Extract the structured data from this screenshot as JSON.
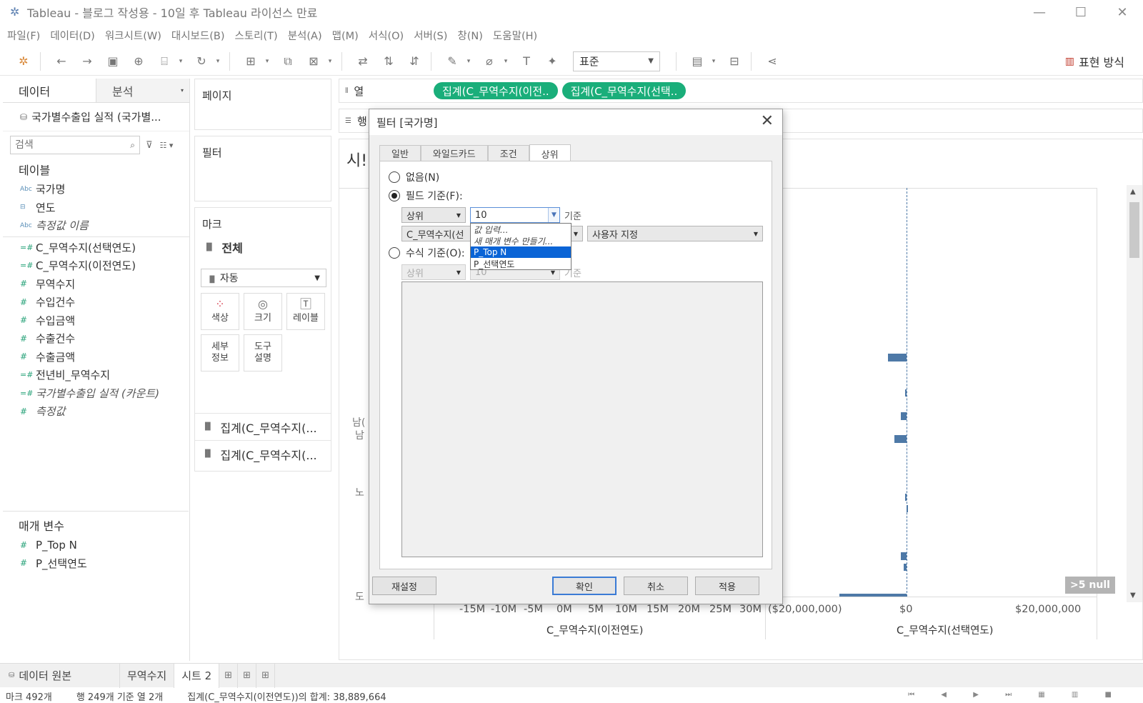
{
  "window": {
    "title": "Tableau - 블로그 작성용 - 10일 후 Tableau 라이선스 만료"
  },
  "menu": [
    "파일(F)",
    "데이터(D)",
    "워크시트(W)",
    "대시보드(B)",
    "스토리(T)",
    "분석(A)",
    "맵(M)",
    "서식(O)",
    "서버(S)",
    "창(N)",
    "도움말(H)"
  ],
  "toolbar": {
    "fit_value": "표준",
    "show_me_label": "표현 방식"
  },
  "data_pane": {
    "tab_data": "데이터",
    "tab_analytics": "분석",
    "datasource": "국가별수출입 실적 (국가별...",
    "search_placeholder": "검색",
    "tables_header": "테이블",
    "fields": [
      {
        "type": "Abc",
        "name": "국가명"
      },
      {
        "type": "date",
        "name": "연도"
      },
      {
        "type": "Abc",
        "name": "측정값 이름"
      },
      {
        "type": "=#",
        "name": "C_무역수지(선택연도)"
      },
      {
        "type": "=#",
        "name": "C_무역수지(이전연도)"
      },
      {
        "type": "#",
        "name": "무역수지"
      },
      {
        "type": "#",
        "name": "수입건수"
      },
      {
        "type": "#",
        "name": "수입금액"
      },
      {
        "type": "#",
        "name": "수출건수"
      },
      {
        "type": "#",
        "name": "수출금액"
      },
      {
        "type": "=#",
        "name": "전년비_무역수지"
      },
      {
        "type": "=#",
        "name": "국가별수출입 실적 (카운트)"
      },
      {
        "type": "#",
        "name": "측정값"
      }
    ],
    "params_header": "매개 변수",
    "params": [
      "P_Top N",
      "P_선택연도"
    ]
  },
  "shelves": {
    "pages": "페이지",
    "filters": "필터",
    "marks": "마크",
    "marks_all": "전체",
    "mark_type": "자동",
    "mark_buttons": [
      "색상",
      "크기",
      "레이블",
      "세부\n정보",
      "도구\n설명"
    ],
    "mark_pills": [
      "집계(C_무역수지(...",
      "집계(C_무역수지(..."
    ],
    "columns_label": "열",
    "rows_label": "행",
    "column_pills": [
      "집계(C_무역수지(이전..",
      "집계(C_무역수지(선택.."
    ]
  },
  "viz": {
    "title": "시!",
    "row_labels": [
      "남(",
      "남",
      "노",
      "도",
      "도이"
    ],
    "axis1_ticks": [
      "-15M",
      "-10M",
      "-5M",
      "0M",
      "5M",
      "10M",
      "15M",
      "20M",
      "25M",
      "30M"
    ],
    "axis1_title": "C_무역수지(이전연도)",
    "axis2_ticks": [
      "($20,000,000)",
      "$0",
      "$20,000,000"
    ],
    "axis2_title": "C_무역수지(선택연도)",
    "null_badge": ">5 null"
  },
  "filter_dialog": {
    "title": "필터 [국가명]",
    "tabs": [
      "일반",
      "와일드카드",
      "조건",
      "상위"
    ],
    "active_tab": "상위",
    "radio_none": "없음(N)",
    "radio_field": "필드 기준(F):",
    "radio_formula": "수식 기준(O):",
    "field_topbottom": "상위",
    "field_value": "10",
    "by_label": "기준",
    "field_measure": "C_무역수지(선",
    "field_agg": "사용자 지정",
    "formula_topbottom": "상위",
    "formula_value": "10",
    "formula_by_label": "기준",
    "dropdown_items": [
      "값 입력...",
      "새 매개 변수 만들기...",
      "P_Top N",
      "P_선택연도"
    ],
    "dropdown_selected": "P_Top N",
    "btn_reset": "재설정",
    "btn_ok": "확인",
    "btn_cancel": "취소",
    "btn_apply": "적용"
  },
  "sheet_tabs": {
    "datasource": "데이터 원본",
    "sheets": [
      "무역수지",
      "시트 2"
    ],
    "active": "시트 2"
  },
  "status": {
    "marks": "마크 492개",
    "rows_cols": "행 249개 기준 열 2개",
    "sum": "집계(C_무역수지(이전연도))의 합계: 38,889,664"
  }
}
